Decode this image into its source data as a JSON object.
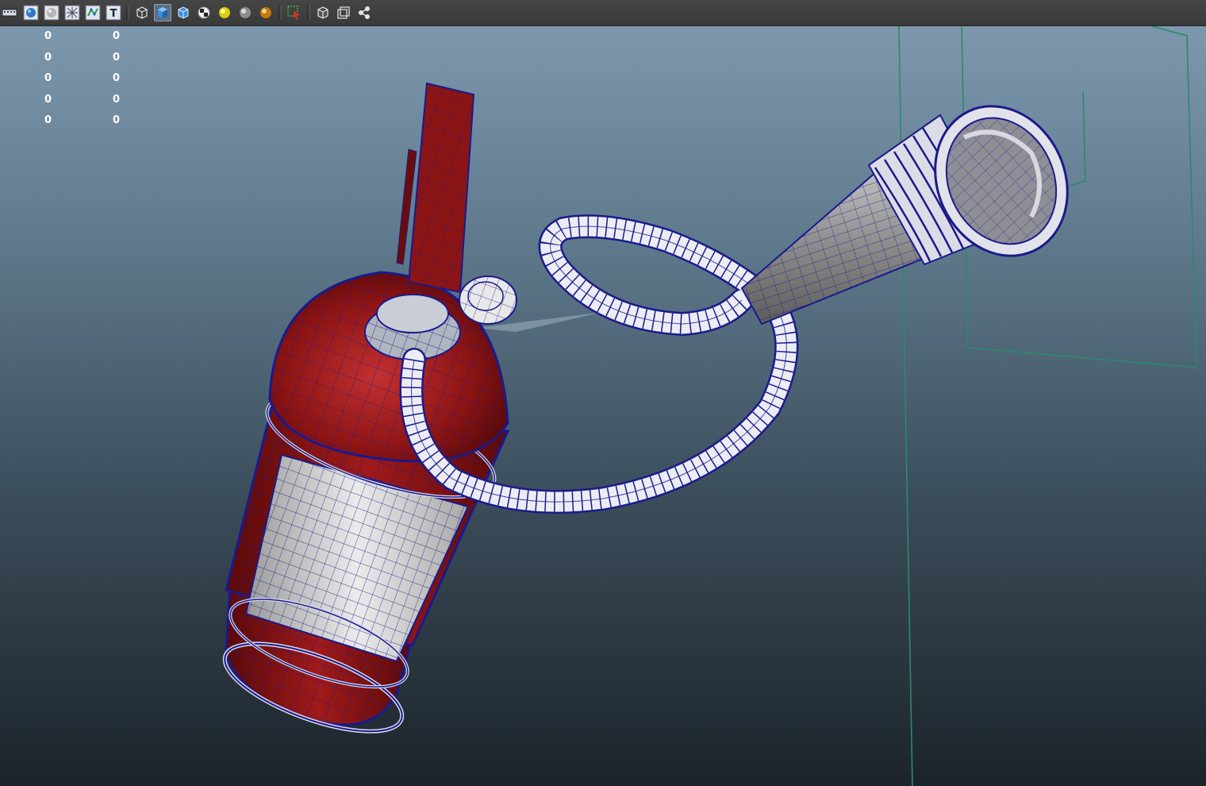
{
  "toolbar": {
    "buttons": [
      {
        "icon": "film-strip-icon"
      },
      {
        "icon": "shaded-sphere-icon"
      },
      {
        "icon": "grey-sphere-icon"
      },
      {
        "icon": "x-ray-grid-icon"
      },
      {
        "icon": "wireframe-on-shaded-icon"
      },
      {
        "icon": "text-t-icon",
        "label": "T"
      },
      {
        "icon": "wireframe-cube-icon"
      },
      {
        "icon": "smooth-cube-icon"
      },
      {
        "icon": "shaded-cube-icon"
      },
      {
        "icon": "checker-icon"
      },
      {
        "icon": "yellow-light-icon"
      },
      {
        "icon": "grey-light-icon"
      },
      {
        "icon": "orange-light-icon"
      },
      {
        "icon": "selection-icon"
      },
      {
        "icon": "isolate-cube-icon"
      },
      {
        "icon": "frame-cube-icon"
      },
      {
        "icon": "share-graph-icon"
      }
    ],
    "active_index": 7
  },
  "hud": {
    "rows": [
      {
        "a": "0",
        "b": "0"
      },
      {
        "a": "0",
        "b": "0"
      },
      {
        "a": "0",
        "b": "0"
      },
      {
        "a": "0",
        "b": "0"
      },
      {
        "a": "0",
        "b": "0"
      }
    ]
  },
  "colors": {
    "body_red": "#8b1212",
    "wire_blue": "#1a1a8c",
    "label_white": "#e8e8e8",
    "camera_green": "#2a8a6a",
    "toolbar_bg": "#3f3f3f"
  }
}
